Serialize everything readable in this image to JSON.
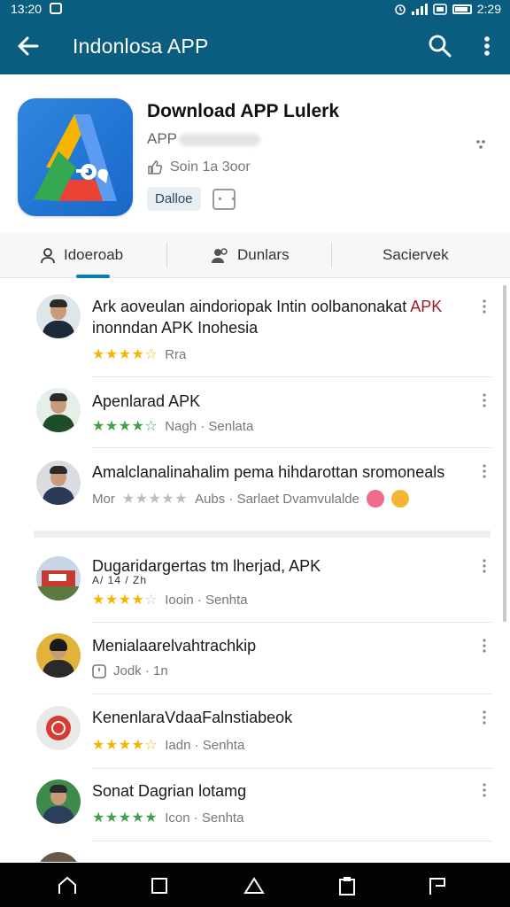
{
  "status_bar": {
    "time_left": "13:20",
    "time_right": "2:29"
  },
  "app_bar": {
    "title": "Indonlosa APP"
  },
  "header": {
    "title": "Download APP Lulerk",
    "developer": "APP",
    "meta": "Soin 1a 3oor",
    "chip": "Dalloe"
  },
  "tabs": [
    {
      "label": "Idoeroab",
      "icon": "person-icon"
    },
    {
      "label": "Dunlars",
      "icon": "people-icon"
    },
    {
      "label": "Saciervek",
      "icon": ""
    }
  ],
  "reviews": [
    {
      "title_main": "Ark aoveulan aindoriopak Intin oolbanonakat ",
      "title_red": "APK",
      "title_line2": "inonndan APK Inohesia",
      "stars": {
        "filled": 4,
        "total": 5,
        "color": "#f2b705"
      },
      "meta": "Rra"
    },
    {
      "title_main": "Apenlarad APK",
      "stars": {
        "filled": 4,
        "total": 5,
        "color": "#3fa24a"
      },
      "meta": "Nagh · Senlata"
    },
    {
      "title_main": "Amalclanalinahalim pema hihdarottan sromoneals",
      "meta_prefix": "Mor",
      "stars": {
        "filled": 0,
        "total": 5,
        "color": "#bdbdbd"
      },
      "meta": "Aubs · Sarlaet Dvamvulalde"
    },
    {
      "title_main": "Dugaridargertas tm lherjad, APK",
      "title_line2": "A/ 14 / Zh",
      "stars": {
        "filled": 4,
        "total": 5,
        "color": "#f2b705"
      },
      "meta": "Iooin · Senhta"
    },
    {
      "title_main": "Menialaarelvahtrachkip",
      "meta": "Jodk · 1n"
    },
    {
      "title_main": "KenenlaraVdaaFalnstiabeok",
      "stars": {
        "filled": 4,
        "total": 5,
        "color": "#f2b705"
      },
      "meta": "Iadn · Senhta"
    },
    {
      "title_main": "Sonat Dagrian lotamg",
      "stars": {
        "filled": 5,
        "total": 5,
        "color": "#3fa24a"
      },
      "meta": "Icon · Senhta"
    }
  ],
  "colors": {
    "brand": "#0a5d7e",
    "accent": "#0a7dae",
    "red": "#a11c25"
  },
  "nav_bar": {
    "icons": [
      "home-outline-icon",
      "square-icon",
      "home-icon",
      "clipboard-icon",
      "flag-icon"
    ]
  }
}
